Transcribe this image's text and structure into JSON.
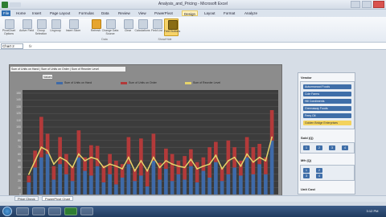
{
  "window": {
    "title": "Analysis_and_Pricing - Microsoft Excel",
    "colors": {
      "chart_bg": "#3c3c3c",
      "pane_item": "#3f6ea8",
      "selected_item": "#f3d35d"
    }
  },
  "ribbon": {
    "tabs": [
      "File",
      "Home",
      "Insert",
      "Page Layout",
      "Formulas",
      "Data",
      "Review",
      "View",
      "PowerPivot",
      "Design",
      "Layout",
      "Format",
      "Analyze"
    ],
    "buttons": [
      {
        "label": "PivotChart Options",
        "icon": "options-icon"
      },
      {
        "label": "Active Field",
        "icon": "field-icon"
      },
      {
        "label": "Group Selection",
        "icon": "group-icon"
      },
      {
        "label": "Ungroup",
        "icon": "ungroup-icon"
      },
      {
        "label": "Insert Slicer",
        "icon": "slicer-icon"
      },
      {
        "label": "Refresh",
        "icon": "refresh-icon"
      },
      {
        "label": "Change Data Source",
        "icon": "datasource-icon"
      },
      {
        "label": "Clear",
        "icon": "clear-icon"
      },
      {
        "label": "Calculations",
        "icon": "calc-icon"
      },
      {
        "label": "Field List",
        "icon": "list-icon"
      },
      {
        "label": "Field Buttons",
        "icon": "field-buttons-icon"
      }
    ],
    "groups": [
      "Data",
      "Show/Hide"
    ]
  },
  "formula": {
    "name_box": "Chart 2",
    "fx": "fx"
  },
  "chart": {
    "value_filter": "Sum of Units on Hand | Sum of Units on Order | Sum of Reorder Level",
    "values_button": "Values"
  },
  "chart_data": {
    "type": "bar",
    "series": [
      {
        "name": "Sum of Units on Hand",
        "color": "#3f6aa8",
        "values": [
          18,
          40,
          55,
          60,
          22,
          45,
          30,
          20,
          55,
          35,
          28,
          42,
          18,
          30,
          15,
          25,
          45,
          20,
          28,
          12,
          50,
          22,
          38,
          20,
          30,
          22,
          42,
          18,
          35,
          25,
          48,
          20,
          30,
          40,
          28,
          55,
          30,
          45,
          30,
          80
        ]
      },
      {
        "name": "Sum of Units on Order",
        "color": "#b33a3a",
        "values": [
          10,
          25,
          60,
          30,
          20,
          40,
          30,
          22,
          40,
          20,
          45,
          30,
          25,
          30,
          35,
          20,
          40,
          18,
          55,
          25,
          40,
          25,
          30,
          40,
          20,
          35,
          25,
          30,
          20,
          45,
          30,
          20,
          50,
          30,
          22,
          30,
          40,
          30,
          25,
          45
        ]
      },
      {
        "name": "Sum of Reorder Level",
        "color": "#e6d36a",
        "values": [
          30,
          50,
          70,
          65,
          45,
          55,
          50,
          40,
          60,
          50,
          55,
          52,
          40,
          45,
          42,
          38,
          55,
          35,
          50,
          35,
          55,
          40,
          50,
          45,
          42,
          40,
          52,
          38,
          42,
          45,
          58,
          38,
          50,
          55,
          42,
          60,
          48,
          55,
          50,
          85
        ]
      }
    ],
    "ylim": [
      0,
      150
    ],
    "yticks": [
      "0",
      "10",
      "20",
      "30",
      "40",
      "50",
      "60",
      "70",
      "80",
      "90",
      "100",
      "110",
      "120",
      "130",
      "140",
      "150"
    ],
    "legend": "top"
  },
  "filter_pane": {
    "title": "Vendor",
    "vendors": [
      "Autumnwood Foods",
      "Cole Farms",
      "Hill Condiments",
      "Greenaway Foods",
      "Ferry Oil",
      "Golden Bridge Enterprises"
    ],
    "selected_index": 5,
    "sections": [
      {
        "title": "Sold (Q)",
        "chips": [
          "1",
          "2",
          "3",
          "4"
        ]
      },
      {
        "title": "Mfr (Q)",
        "chips": [
          "1",
          "2",
          "3",
          "4"
        ]
      },
      {
        "title": "Unit Cost",
        "chips": []
      }
    ]
  },
  "sheets": [
    "Price Check",
    "PowerPivot Chart"
  ],
  "taskbar": {
    "clock": "3:12 PM"
  }
}
